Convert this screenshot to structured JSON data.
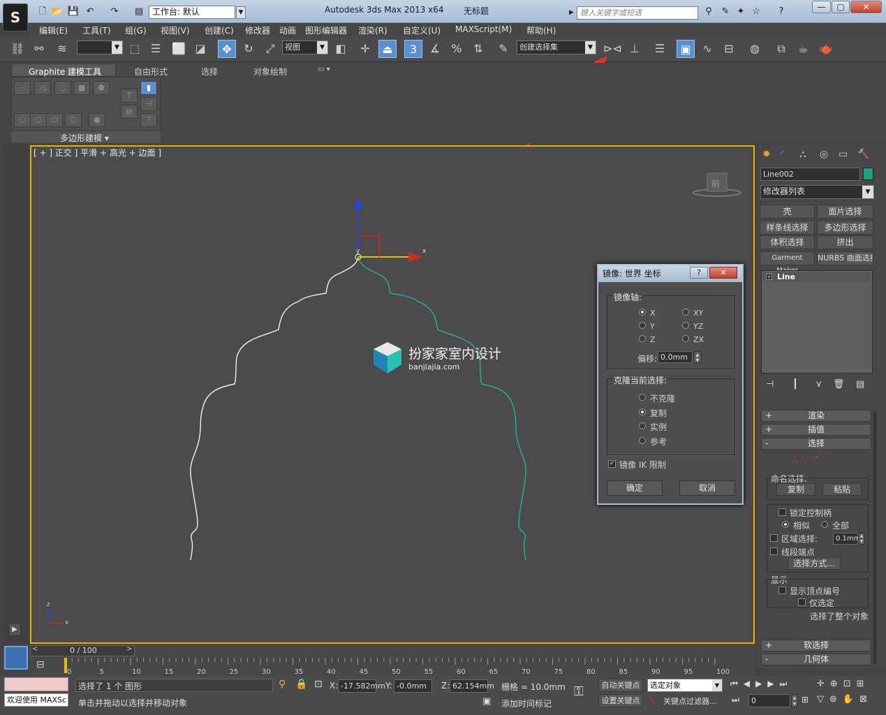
{
  "title_bar": {
    "logo": "S",
    "workspace": "工作台: 默认",
    "app_name": "Autodesk 3ds Max  2013 x64",
    "doc_title": "无标题",
    "search_placeholder": "键入关键字或短语",
    "window_buttons": [
      "—",
      "▢",
      "✕"
    ]
  },
  "menu": [
    "编辑(E)",
    "工具(T)",
    "组(G)",
    "视图(V)",
    "创建(C)",
    "修改器",
    "动画",
    "图形编辑器",
    "渲染(R)",
    "自定义(U)",
    "MAXScript(M)",
    "帮助(H)"
  ],
  "toolbar": {
    "ref_coord": "视图",
    "named_selection": "创建选择集"
  },
  "ribbon": {
    "tabs": [
      "Graphite 建模工具",
      "自由形式",
      "选择",
      "对象绘制"
    ],
    "panel_label": "多边形建模"
  },
  "viewport": {
    "label": "[ + ] 正交 ] 平滑 + 高光 + 边面 ]",
    "axis_x": "x",
    "axis_y": "y",
    "axis_z": "z",
    "viewcube_label": "前",
    "watermark_title": "扮家家室内设计",
    "watermark_url": "banjiajia.com"
  },
  "dialog": {
    "title": "镜像: 世界 坐标",
    "mirror_axis_label": "镜像轴:",
    "axes": [
      "X",
      "Y",
      "Z",
      "XY",
      "YZ",
      "ZX"
    ],
    "selected_axis": "X",
    "offset_label": "偏移:",
    "offset_value": "0.0mm",
    "clone_label": "克隆当前选择:",
    "clone_options": [
      "不克隆",
      "复制",
      "实例",
      "参考"
    ],
    "selected_clone": "复制",
    "ik_label": "镜像 IK 限制",
    "ik_checked": true,
    "ok": "确定",
    "cancel": "取消"
  },
  "command_panel": {
    "object_name": "Line002",
    "object_color": "#1fa37f",
    "modifier_list": "修改器列表",
    "buttons": [
      "壳",
      "面片选择",
      "样条线选择",
      "多边形选择",
      "体积选择",
      "挤出",
      "Garment Maker",
      "NURBS 曲面选择"
    ],
    "stack_item": "Line",
    "rollouts": {
      "render": "渲染",
      "interp": "插值",
      "select": "选择",
      "soft_select": "软选择",
      "geometry": "几何体"
    },
    "named_sel_label": "命名选择:",
    "copy": "复制",
    "paste": "粘贴",
    "lock_handles": "锁定控制柄",
    "similar": "相似",
    "all": "全部",
    "area_select": "区域选择:",
    "area_value": "0.1mm",
    "segment_end": "线段端点",
    "select_by": "选择方式...",
    "display_label": "显示",
    "show_vertex_numbers": "显示顶点编号",
    "selected_only": "仅选定",
    "status_text": "选择了整个对象"
  },
  "timeline": {
    "frame_display": "0 / 100",
    "ticks": [
      "0",
      "5",
      "10",
      "15",
      "20",
      "25",
      "30",
      "35",
      "40",
      "45",
      "50",
      "55",
      "60",
      "65",
      "70",
      "75",
      "80",
      "85",
      "90",
      "95",
      "100"
    ]
  },
  "status": {
    "welcome": "欢迎使用 MAXSc",
    "selection": "选择了 1 个 图形",
    "hint": "单击并拖动以选择并移动对象",
    "x_label": "X:",
    "x_value": "-17.582mm",
    "y_label": "Y:",
    "y_value": "-0.0mm",
    "z_label": "Z:",
    "z_value": "62.154mm",
    "grid": "栅格 = 10.0mm",
    "add_time_tag": "添加时间标记",
    "auto_key": "自动关键点",
    "set_key": "设置关键点",
    "selected_object": "选定对象",
    "key_filters": "关键点过滤器...",
    "frame": "0"
  }
}
